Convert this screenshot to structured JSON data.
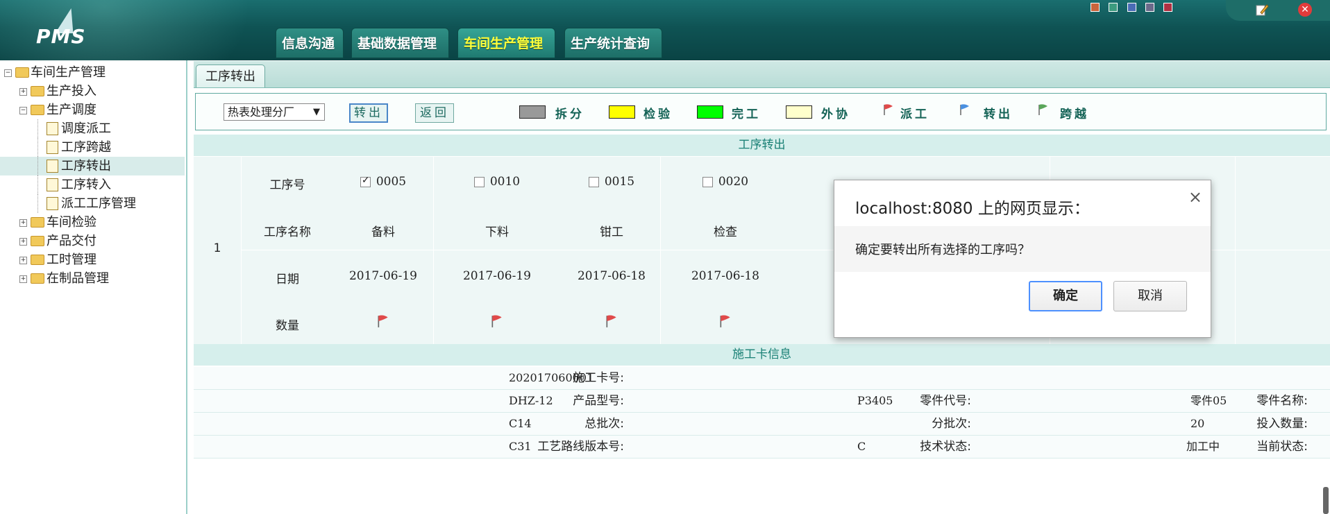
{
  "header": {
    "logo": "PMS",
    "tabs": [
      {
        "label": "信息沟通",
        "active": false
      },
      {
        "label": "基础数据管理",
        "active": false
      },
      {
        "label": "车间生产管理",
        "active": true
      },
      {
        "label": "生产统计查询",
        "active": false
      }
    ],
    "window_colors": [
      "#c9643c",
      "#3d9b7f",
      "#4a6cb6",
      "#6a6a8a",
      "#b03042"
    ]
  },
  "sidebar": {
    "root": "车间生产管理",
    "items": [
      {
        "label": "生产投入",
        "level": 1,
        "type": "folder",
        "state": "collapsed"
      },
      {
        "label": "生产调度",
        "level": 1,
        "type": "folder",
        "state": "expanded"
      },
      {
        "label": "调度派工",
        "level": 2,
        "type": "doc"
      },
      {
        "label": "工序跨越",
        "level": 2,
        "type": "doc"
      },
      {
        "label": "工序转出",
        "level": 2,
        "type": "doc",
        "selected": true
      },
      {
        "label": "工序转入",
        "level": 2,
        "type": "doc"
      },
      {
        "label": "派工工序管理",
        "level": 2,
        "type": "doc"
      },
      {
        "label": "车间检验",
        "level": 1,
        "type": "folder",
        "state": "collapsed"
      },
      {
        "label": "产品交付",
        "level": 1,
        "type": "folder",
        "state": "collapsed"
      },
      {
        "label": "工时管理",
        "level": 1,
        "type": "folder",
        "state": "collapsed"
      },
      {
        "label": "在制品管理",
        "level": 1,
        "type": "folder",
        "state": "collapsed"
      }
    ]
  },
  "main": {
    "tab": "工序转出",
    "toolbar": {
      "factory": "热表处理分厂",
      "transfer_out": "转出",
      "back": "返回",
      "legend": [
        {
          "label": "拆分",
          "color": "#999999"
        },
        {
          "label": "检验",
          "color": "#ffff00"
        },
        {
          "label": "完工",
          "color": "#00ff00"
        },
        {
          "label": "外协",
          "color": "#ffffcc"
        }
      ],
      "flags": [
        {
          "label": "派工",
          "color": "#e04a4a"
        },
        {
          "label": "转出",
          "color": "#4a90e0"
        },
        {
          "label": "跨越",
          "color": "#5aa65a"
        }
      ]
    },
    "section_process": "工序转出",
    "process": {
      "row_index": "1",
      "labels": {
        "no": "工序号",
        "name": "工序名称",
        "date": "日期",
        "qty": "数量"
      },
      "items": [
        {
          "no": "0005",
          "checked": true,
          "name": "备料",
          "date": "2017-06-19"
        },
        {
          "no": "0010",
          "checked": false,
          "name": "下料",
          "date": "2017-06-19"
        },
        {
          "no": "0015",
          "checked": false,
          "name": "钳工",
          "date": "2017-06-18"
        },
        {
          "no": "0020",
          "checked": false,
          "name": "检查",
          "date": "2017-06-18"
        }
      ]
    },
    "section_card": "施工卡信息",
    "card": {
      "card_no_label": "施工卡号:",
      "card_no": "202017060001",
      "model_label": "产品型号:",
      "model": "DHZ-12",
      "part_code_label": "零件代号:",
      "part_code": "P3405",
      "part_name_label": "零件名称:",
      "part_name": "零件05",
      "batch_label": "总批次:",
      "batch": "C14",
      "sub_batch_label": "分批次:",
      "sub_batch": "",
      "input_qty_label": "投入数量:",
      "input_qty": "20",
      "route_label": "工艺路线版本号:",
      "route": "C31",
      "tech_label": "技术状态:",
      "tech": "C",
      "status_label": "当前状态:",
      "status": "加工中"
    }
  },
  "dialog": {
    "title": "localhost:8080 上的网页显示：",
    "message": "确定要转出所有选择的工序吗？",
    "ok": "确定",
    "cancel": "取消"
  }
}
